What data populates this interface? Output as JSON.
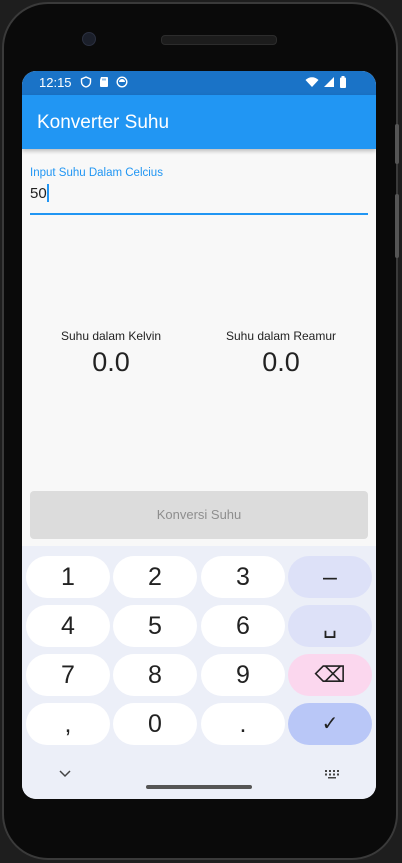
{
  "status_bar": {
    "time": "12:15"
  },
  "app_bar": {
    "title": "Konverter Suhu"
  },
  "input": {
    "label": "Input Suhu Dalam Celcius",
    "value": "50"
  },
  "results": [
    {
      "label": "Suhu dalam Kelvin",
      "value": "0.0"
    },
    {
      "label": "Suhu dalam Reamur",
      "value": "0.0"
    }
  ],
  "convert_button": {
    "label": "Konversi Suhu",
    "enabled": false
  },
  "keyboard": {
    "keys": [
      "1",
      "2",
      "3",
      "–",
      "4",
      "5",
      "6",
      "␣",
      "7",
      "8",
      "9",
      "⌫",
      ",",
      "0",
      ".",
      "✓"
    ]
  },
  "colors": {
    "primary": "#2196f3",
    "status_bar": "#1a73c7",
    "keyboard_bg": "#eceff8"
  }
}
